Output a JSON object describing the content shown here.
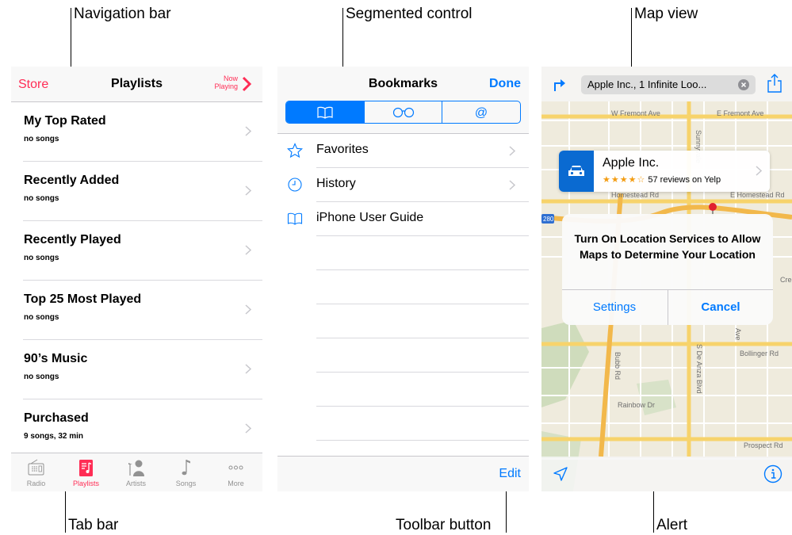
{
  "callouts": {
    "navigation_bar": "Navigation bar",
    "segmented_control": "Segmented control",
    "map_view": "Map view",
    "tab_bar": "Tab bar",
    "toolbar_button": "Toolbar button",
    "alert": "Alert"
  },
  "music": {
    "nav": {
      "left": "Store",
      "title": "Playlists",
      "now_line1": "Now",
      "now_line2": "Playing"
    },
    "playlists": [
      {
        "title": "My Top Rated",
        "subtitle": "no songs"
      },
      {
        "title": "Recently Added",
        "subtitle": "no songs"
      },
      {
        "title": "Recently Played",
        "subtitle": "no songs"
      },
      {
        "title": "Top 25 Most Played",
        "subtitle": "no songs"
      },
      {
        "title": "90’s Music",
        "subtitle": "no songs"
      },
      {
        "title": "Purchased",
        "subtitle": "9 songs, 32 min"
      }
    ],
    "tabs": [
      {
        "label": "Radio",
        "icon": "radio-icon"
      },
      {
        "label": "Playlists",
        "icon": "playlists-icon",
        "selected": true
      },
      {
        "label": "Artists",
        "icon": "artists-icon"
      },
      {
        "label": "Songs",
        "icon": "songs-icon"
      },
      {
        "label": "More",
        "icon": "more-icon"
      }
    ],
    "accent": "#ff2d55"
  },
  "bookmarks": {
    "title": "Bookmarks",
    "done": "Done",
    "segments": [
      {
        "icon": "book-icon",
        "selected": true
      },
      {
        "icon": "reading-list-glasses-icon"
      },
      {
        "icon": "shared-links-at-icon"
      }
    ],
    "items": [
      {
        "label": "Favorites",
        "icon": "star-icon",
        "chevron": true
      },
      {
        "label": "History",
        "icon": "clock-icon",
        "chevron": true
      },
      {
        "label": "iPhone User Guide",
        "icon": "book-icon",
        "chevron": false
      }
    ],
    "toolbar_button": "Edit",
    "accent": "#007aff"
  },
  "maps": {
    "search_text": "Apple Inc., 1 Infinite Loo...",
    "place": {
      "name": "Apple Inc.",
      "stars": "★★★★☆",
      "reviews": "57 reviews on Yelp"
    },
    "alert": {
      "message": "Turn On Location Services to Allow Maps to Determine Your Location",
      "left_button": "Settings",
      "right_button": "Cancel"
    },
    "street_labels": {
      "fremont_w": "W Fremont Ave",
      "fremont_e": "E Fremont Ave",
      "sunnyvale": "Sunnyvale",
      "homestead": "Homestead Rd",
      "homestead_e": "E Homestead Rd",
      "i280": "280",
      "creek": "Cree",
      "ave": "Ave",
      "bollinger": "Bollinger Rd",
      "de_anza": "S De Anza Blvd",
      "bubb": "Bubb Rd",
      "rainbow": "Rainbow Dr",
      "prospect": "Prospect Rd"
    }
  }
}
